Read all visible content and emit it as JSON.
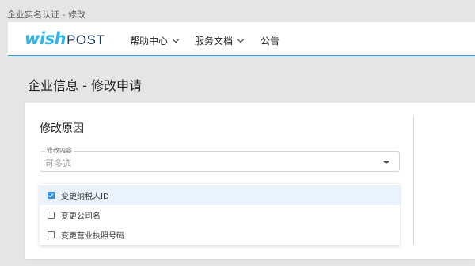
{
  "window": {
    "tab_title": "企业实名认证 - 修改"
  },
  "brand": {
    "wish": "wish",
    "post": "POST",
    "accent": "#2fb7ec",
    "dark": "#1d3a5a"
  },
  "nav": {
    "items": [
      {
        "label": "帮助中心",
        "has_dropdown": true
      },
      {
        "label": "服务文档",
        "has_dropdown": true
      },
      {
        "label": "公告",
        "has_dropdown": false
      }
    ]
  },
  "page": {
    "heading": "企业信息 - 修改申请"
  },
  "form": {
    "section_title": "修改原因",
    "field": {
      "label": "修改内容",
      "placeholder": "可多选"
    },
    "options": [
      {
        "label": "变更纳税人ID",
        "checked": true
      },
      {
        "label": "变更公司名",
        "checked": false
      },
      {
        "label": "变更营业执照号码",
        "checked": false
      }
    ]
  }
}
